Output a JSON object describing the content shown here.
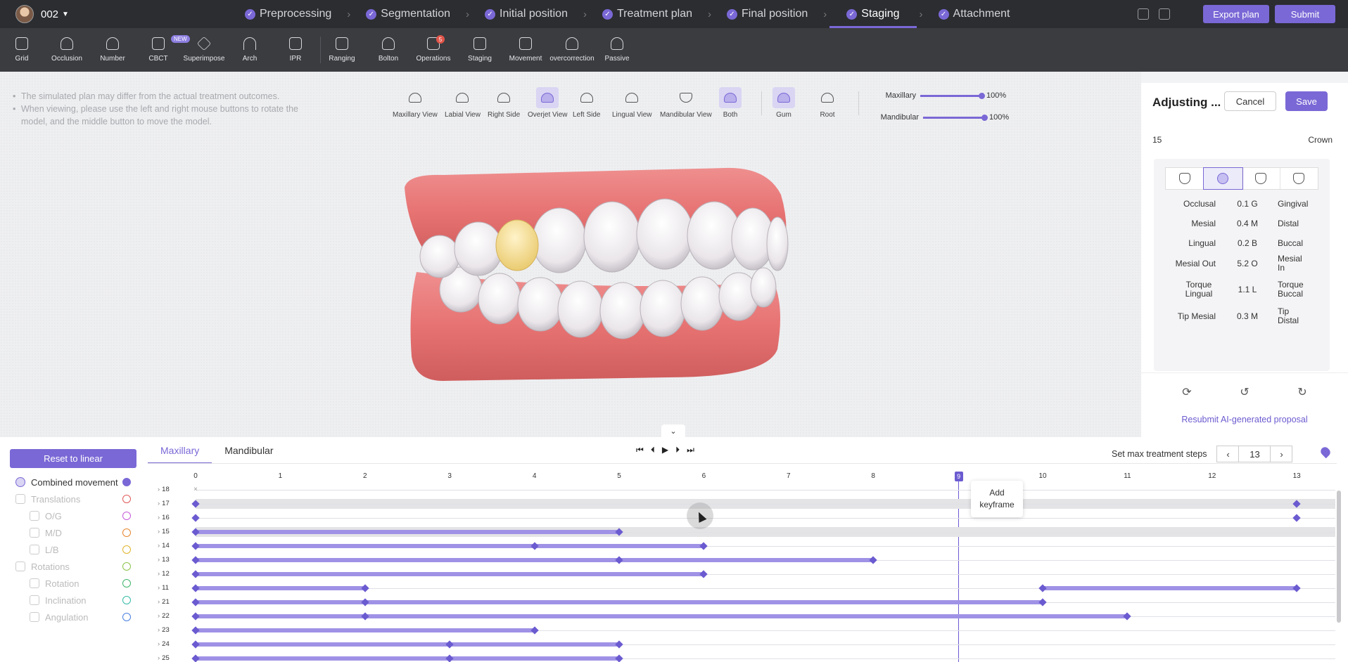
{
  "user": {
    "name": "002"
  },
  "steps": [
    {
      "label": "Preprocessing"
    },
    {
      "label": "Segmentation"
    },
    {
      "label": "Initial position"
    },
    {
      "label": "Treatment plan"
    },
    {
      "label": "Final position"
    },
    {
      "label": "Staging",
      "active": true
    },
    {
      "label": "Attachment"
    }
  ],
  "header": {
    "export_label": "Export plan",
    "submit_label": "Submit"
  },
  "toolbar": {
    "grid": "Grid",
    "occlusion": "Occlusion",
    "number": "Number",
    "cbct": "CBCT",
    "cbct_badge": "NEW",
    "superimpose": "Superimpose",
    "arch": "Arch",
    "ipr": "IPR",
    "ranging": "Ranging",
    "bolton": "Bolton",
    "operations": "Operations",
    "operations_badge": "5",
    "staging": "Staging",
    "movement": "Movement",
    "overcorrection": "overcorrection",
    "passive": "Passive"
  },
  "notes": [
    "The simulated plan may differ from the actual treatment outcomes.",
    "When viewing, please use the left and right mouse buttons to rotate the model, and the middle button to move the model."
  ],
  "views": {
    "maxillary": "Maxillary View",
    "labial": "Labial View",
    "right": "Right Side",
    "overjet": "Overjet View",
    "left": "Left Side",
    "lingual": "Lingual View",
    "mandibular": "Mandibular View",
    "both": "Both",
    "gum": "Gum",
    "root": "Root"
  },
  "opacity": {
    "maxillary_label": "Maxillary",
    "maxillary_value": "100%",
    "mandibular_label": "Mandibular",
    "mandibular_value": "100%"
  },
  "panel": {
    "title": "Adjusting ...",
    "cancel": "Cancel",
    "save": "Save",
    "tooth": "15",
    "mode": "Crown",
    "rows": [
      {
        "a": "Occlusal",
        "v": "0.1 G",
        "b": "Gingival"
      },
      {
        "a": "Mesial",
        "v": "0.4 M",
        "b": "Distal"
      },
      {
        "a": "Lingual",
        "v": "0.2 B",
        "b": "Buccal"
      },
      {
        "a": "Mesial Out",
        "v": "5.2 O",
        "b": "Mesial In"
      },
      {
        "a": "Torque Lingual",
        "v": "1.1 L",
        "b": "Torque Buccal"
      },
      {
        "a": "Tip Mesial",
        "v": "0.3 M",
        "b": "Tip Distal"
      }
    ],
    "resubmit": "Resubmit AI-generated proposal"
  },
  "timeline": {
    "reset": "Reset to linear",
    "tab_max": "Maxillary",
    "tab_mand": "Mandibular",
    "max_steps_label": "Set max treatment steps",
    "max_steps_value": "13",
    "current_step": "9",
    "tooltip": "Add keyframe",
    "legend": [
      {
        "label": "Combined movement",
        "color": "#7a68d6",
        "filled": true
      },
      {
        "label": "Translations",
        "color": "#e05a5a"
      },
      {
        "label": "O/G",
        "color": "#c65ad8"
      },
      {
        "label": "M/D",
        "color": "#e5852e"
      },
      {
        "label": "L/B",
        "color": "#e0b52c"
      },
      {
        "label": "Rotations",
        "color": "#8bc34a"
      },
      {
        "label": "Rotation",
        "color": "#3fb56b"
      },
      {
        "label": "Inclination",
        "color": "#35bba7"
      },
      {
        "label": "Angulation",
        "color": "#4a7fe0"
      }
    ],
    "ticks": [
      "0",
      "1",
      "2",
      "3",
      "4",
      "5",
      "6",
      "7",
      "8",
      "9",
      "10",
      "11",
      "12",
      "13"
    ],
    "rows": [
      {
        "tooth": "18",
        "keys": [],
        "segs": [],
        "x": true
      },
      {
        "tooth": "17",
        "keys": [
          0,
          13
        ],
        "segs": [],
        "hl": true
      },
      {
        "tooth": "16",
        "keys": [
          0,
          13
        ],
        "segs": []
      },
      {
        "tooth": "15",
        "keys": [
          0,
          5
        ],
        "segs": [
          [
            0,
            5
          ]
        ],
        "hl": true
      },
      {
        "tooth": "14",
        "keys": [
          0,
          4,
          6
        ],
        "segs": [
          [
            0,
            6
          ]
        ]
      },
      {
        "tooth": "13",
        "keys": [
          0,
          5,
          8
        ],
        "segs": [
          [
            0,
            8
          ]
        ]
      },
      {
        "tooth": "12",
        "keys": [
          0,
          6
        ],
        "segs": [
          [
            0,
            6
          ]
        ]
      },
      {
        "tooth": "11",
        "keys": [
          0,
          2,
          10,
          13
        ],
        "segs": [
          [
            0,
            2
          ],
          [
            10,
            13
          ]
        ]
      },
      {
        "tooth": "21",
        "keys": [
          0,
          2,
          10
        ],
        "segs": [
          [
            0,
            10
          ]
        ]
      },
      {
        "tooth": "22",
        "keys": [
          0,
          2,
          11
        ],
        "segs": [
          [
            0,
            11
          ]
        ]
      },
      {
        "tooth": "23",
        "keys": [
          0,
          4
        ],
        "segs": [
          [
            0,
            4
          ]
        ]
      },
      {
        "tooth": "24",
        "keys": [
          0,
          3,
          5
        ],
        "segs": [
          [
            0,
            5
          ]
        ]
      },
      {
        "tooth": "25",
        "keys": [
          0,
          3,
          5
        ],
        "segs": [
          [
            0,
            5
          ]
        ]
      }
    ]
  }
}
